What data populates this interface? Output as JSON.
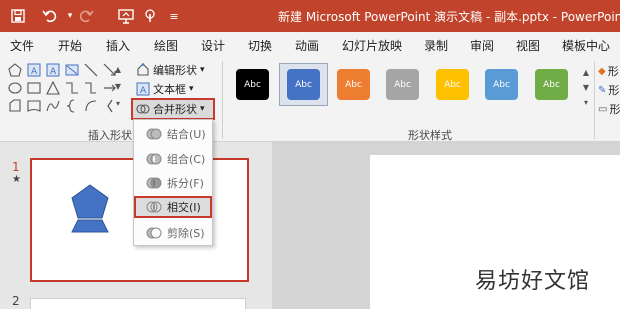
{
  "window": {
    "title": "新建 Microsoft PowerPoint 演示文稿 - 副本.pptx  -  PowerPoint",
    "title_bar_color": "#c1432b"
  },
  "quick_access": {
    "icons": [
      "save-icon",
      "undo-icon",
      "undo-dropdown-icon",
      "redo-icon",
      "presentation-icon",
      "touch-mode-icon",
      "customize-icon"
    ]
  },
  "tabs": [
    "文件",
    "开始",
    "插入",
    "绘图",
    "设计",
    "切换",
    "动画",
    "幻灯片放映",
    "录制",
    "审阅",
    "视图",
    "模板中心"
  ],
  "ribbon": {
    "insert_shapes": {
      "edit_shape": "编辑形状",
      "text_box": "文本框",
      "merge_shapes": "合并形状",
      "group_label": "插入形状"
    },
    "shape_styles": {
      "sample_text": "Abc",
      "group_label": "形状样式",
      "swatches": [
        "#000000",
        "#4472c4",
        "#ed7d31",
        "#a5a5a5",
        "#ffc000",
        "#5b9bd5",
        "#70ad47"
      ]
    },
    "right_items": [
      "形",
      "形",
      "形"
    ]
  },
  "merge_menu": {
    "items": [
      {
        "label": "结合(U)",
        "icon": "union-icon"
      },
      {
        "label": "组合(C)",
        "icon": "combine-icon"
      },
      {
        "label": "拆分(F)",
        "icon": "fragment-icon"
      },
      {
        "label": "相交(I)",
        "icon": "intersect-icon"
      },
      {
        "label": "剪除(S)",
        "icon": "subtract-icon"
      }
    ],
    "selected": "相交(I)"
  },
  "slides": {
    "slide1_number": "1",
    "slide1_marker": "★",
    "slide2_number": "2",
    "shape_color": "#4472c4"
  },
  "watermark": "易坊好文馆"
}
